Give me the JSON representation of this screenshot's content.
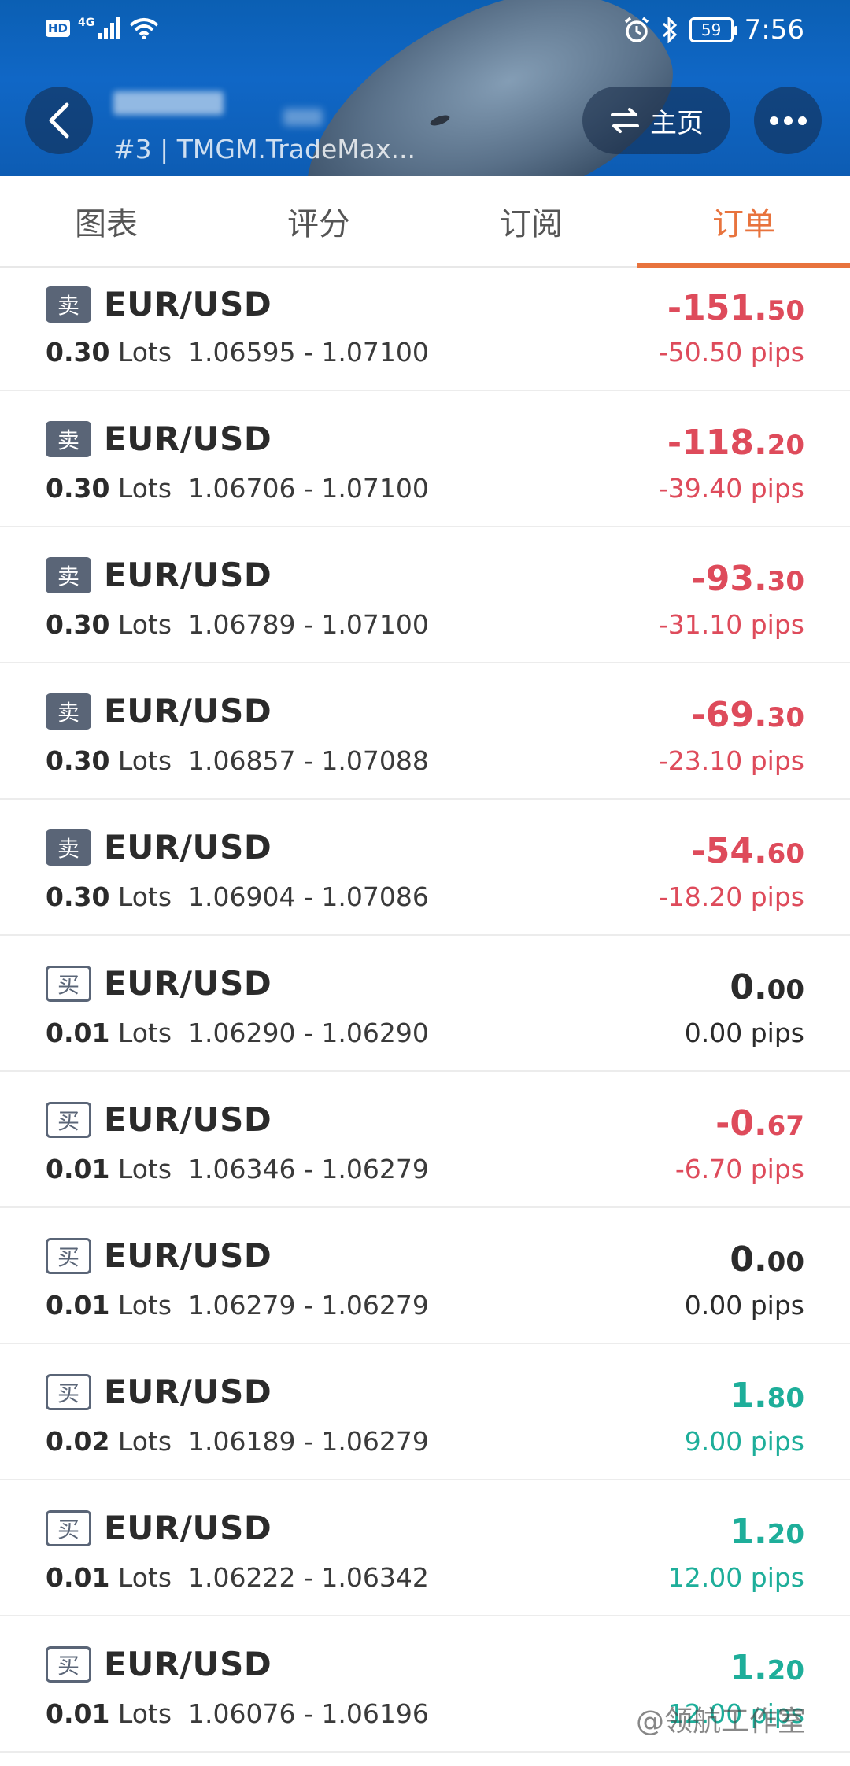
{
  "status_bar": {
    "hd": "HD",
    "network": "4G",
    "battery": "59",
    "time": "7:56"
  },
  "header": {
    "account_info": "#3 | TMGM.TradeMax...",
    "home_label": "主页"
  },
  "tabs": [
    {
      "label": "图表",
      "active": false
    },
    {
      "label": "评分",
      "active": false
    },
    {
      "label": "订阅",
      "active": false
    },
    {
      "label": "订单",
      "active": true
    }
  ],
  "orders": [
    {
      "side": "卖",
      "type": "sell",
      "symbol": "EUR/USD",
      "lots": "0.30",
      "lots_label": "Lots",
      "prices": "1.06595 - 1.07100",
      "pnl_int": "-151.",
      "pnl_dec": "50",
      "pips": "-50.50 pips",
      "status": "neg"
    },
    {
      "side": "卖",
      "type": "sell",
      "symbol": "EUR/USD",
      "lots": "0.30",
      "lots_label": "Lots",
      "prices": "1.06706 - 1.07100",
      "pnl_int": "-118.",
      "pnl_dec": "20",
      "pips": "-39.40 pips",
      "status": "neg"
    },
    {
      "side": "卖",
      "type": "sell",
      "symbol": "EUR/USD",
      "lots": "0.30",
      "lots_label": "Lots",
      "prices": "1.06789 - 1.07100",
      "pnl_int": "-93.",
      "pnl_dec": "30",
      "pips": "-31.10 pips",
      "status": "neg"
    },
    {
      "side": "卖",
      "type": "sell",
      "symbol": "EUR/USD",
      "lots": "0.30",
      "lots_label": "Lots",
      "prices": "1.06857 - 1.07088",
      "pnl_int": "-69.",
      "pnl_dec": "30",
      "pips": "-23.10 pips",
      "status": "neg"
    },
    {
      "side": "卖",
      "type": "sell",
      "symbol": "EUR/USD",
      "lots": "0.30",
      "lots_label": "Lots",
      "prices": "1.06904 - 1.07086",
      "pnl_int": "-54.",
      "pnl_dec": "60",
      "pips": "-18.20 pips",
      "status": "neg"
    },
    {
      "side": "买",
      "type": "buy",
      "symbol": "EUR/USD",
      "lots": "0.01",
      "lots_label": "Lots",
      "prices": "1.06290 - 1.06290",
      "pnl_int": "0.",
      "pnl_dec": "00",
      "pips": "0.00 pips",
      "status": "zero"
    },
    {
      "side": "买",
      "type": "buy",
      "symbol": "EUR/USD",
      "lots": "0.01",
      "lots_label": "Lots",
      "prices": "1.06346 - 1.06279",
      "pnl_int": "-0.",
      "pnl_dec": "67",
      "pips": "-6.70 pips",
      "status": "neg"
    },
    {
      "side": "买",
      "type": "buy",
      "symbol": "EUR/USD",
      "lots": "0.01",
      "lots_label": "Lots",
      "prices": "1.06279 - 1.06279",
      "pnl_int": "0.",
      "pnl_dec": "00",
      "pips": "0.00 pips",
      "status": "zero"
    },
    {
      "side": "买",
      "type": "buy",
      "symbol": "EUR/USD",
      "lots": "0.02",
      "lots_label": "Lots",
      "prices": "1.06189 - 1.06279",
      "pnl_int": "1.",
      "pnl_dec": "80",
      "pips": "9.00 pips",
      "status": "pos"
    },
    {
      "side": "买",
      "type": "buy",
      "symbol": "EUR/USD",
      "lots": "0.01",
      "lots_label": "Lots",
      "prices": "1.06222 - 1.06342",
      "pnl_int": "1.",
      "pnl_dec": "20",
      "pips": "12.00 pips",
      "status": "pos"
    },
    {
      "side": "买",
      "type": "buy",
      "symbol": "EUR/USD",
      "lots": "0.01",
      "lots_label": "Lots",
      "prices": "1.06076 - 1.06196",
      "pnl_int": "1.",
      "pnl_dec": "20",
      "pips": "12.00 pips",
      "status": "pos"
    }
  ],
  "watermark": "@领航工作室",
  "colors": {
    "accent": "#e8733d",
    "negative": "#de4b5b",
    "positive": "#1eae9a",
    "sell_badge": "#5a6577",
    "header_bg": "#0b5fb3"
  }
}
